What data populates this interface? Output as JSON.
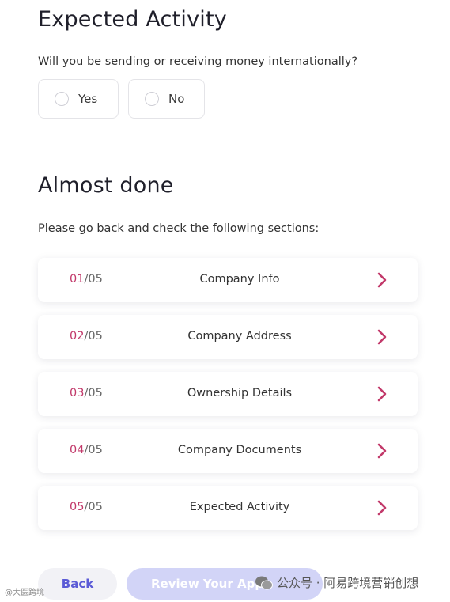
{
  "expected_activity": {
    "title": "Expected Activity",
    "question": "Will you be sending or receiving money internationally?",
    "options": [
      {
        "label": "Yes",
        "selected": false
      },
      {
        "label": "No",
        "selected": false
      }
    ]
  },
  "almost_done": {
    "title": "Almost done",
    "instruction": "Please go back and check the following sections:",
    "sections": [
      {
        "num": "01",
        "total": "/05",
        "name": "Company Info"
      },
      {
        "num": "02",
        "total": "/05",
        "name": "Company Address"
      },
      {
        "num": "03",
        "total": "/05",
        "name": "Ownership Details"
      },
      {
        "num": "04",
        "total": "/05",
        "name": "Company Documents"
      },
      {
        "num": "05",
        "total": "/05",
        "name": "Expected Activity"
      }
    ]
  },
  "footer": {
    "back_label": "Back",
    "review_label": "Review Your Appl"
  },
  "watermark": {
    "right_text": "公众号 · 阿易跨境营销创想",
    "left_text": "@大医跨境"
  },
  "colors": {
    "accent": "#c2396a",
    "primary": "#5b5bd6",
    "disabled_button": "#d2d4f7"
  }
}
